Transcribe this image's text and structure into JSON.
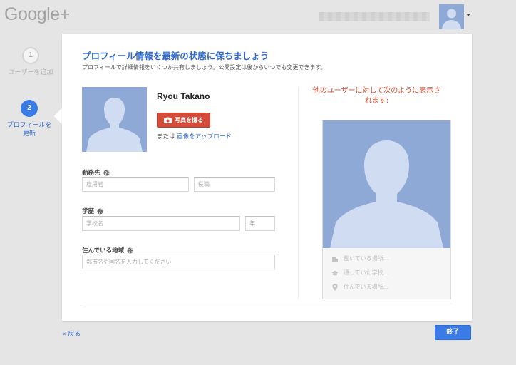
{
  "header": {
    "logo_text": "Google+"
  },
  "steps": [
    {
      "number": "1",
      "label": "ユーザーを追加"
    },
    {
      "number": "2",
      "label": "プロフィールを更新"
    }
  ],
  "main": {
    "title": "プロフィール情報を最新の状態に保ちましょう",
    "subtitle": "プロフィールで詳細情報をいくつか共有しましょう。公開設定は後からいつでも変更できます。",
    "profile_name": "Ryou Takano",
    "take_photo_label": "写真を撮る",
    "or_text": "または",
    "upload_link": "画像をアップロード",
    "work": {
      "label": "勤務先",
      "employer_placeholder": "雇用者",
      "title_placeholder": "役職"
    },
    "education": {
      "label": "学歴",
      "school_placeholder": "学校名",
      "year_placeholder": "年"
    },
    "location": {
      "label": "住んでいる地域",
      "placeholder": "都市名や国名を入力してください"
    }
  },
  "preview": {
    "title": "他のユーザーに対して次のように表示されます:",
    "work_text": "働いている場所...",
    "school_text": "通っていた学校...",
    "location_text": "住んでいる場所..."
  },
  "footer": {
    "back_label": "« 戻る",
    "finish_label": "終了"
  },
  "colors": {
    "accent": "#3a7be6",
    "photo_button": "#d54b3a",
    "avatar_bg": "#8fa9d6"
  }
}
